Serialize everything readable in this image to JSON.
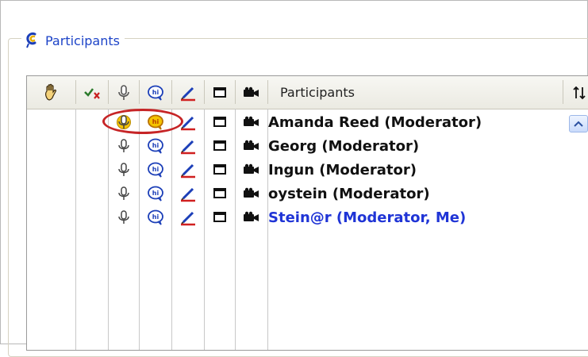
{
  "panel": {
    "title": "Participants",
    "icon": "participants-icon"
  },
  "table": {
    "columns": [
      {
        "icon": "raise-hand-icon"
      },
      {
        "icon": "approve-deny-icon"
      },
      {
        "icon": "microphone-icon"
      },
      {
        "icon": "chat-icon"
      },
      {
        "icon": "pen-icon"
      },
      {
        "icon": "screen-icon"
      },
      {
        "icon": "video-camera-icon"
      },
      {
        "label": "Participants"
      },
      {
        "icon": "sort-icon"
      }
    ],
    "header_label": "Participants",
    "rows": [
      {
        "name": "Amanda Reed (Moderator)",
        "highlighted": true,
        "is_me": false
      },
      {
        "name": "Georg (Moderator)",
        "highlighted": false,
        "is_me": false
      },
      {
        "name": "Ingun (Moderator)",
        "highlighted": false,
        "is_me": false
      },
      {
        "name": "oystein (Moderator)",
        "highlighted": false,
        "is_me": false
      },
      {
        "name": "Stein@r (Moderator, Me)",
        "highlighted": false,
        "is_me": true
      }
    ]
  },
  "colors": {
    "me": "#1f34d6",
    "highlight_ring": "#c62426",
    "legend_text": "#1d44c8"
  }
}
